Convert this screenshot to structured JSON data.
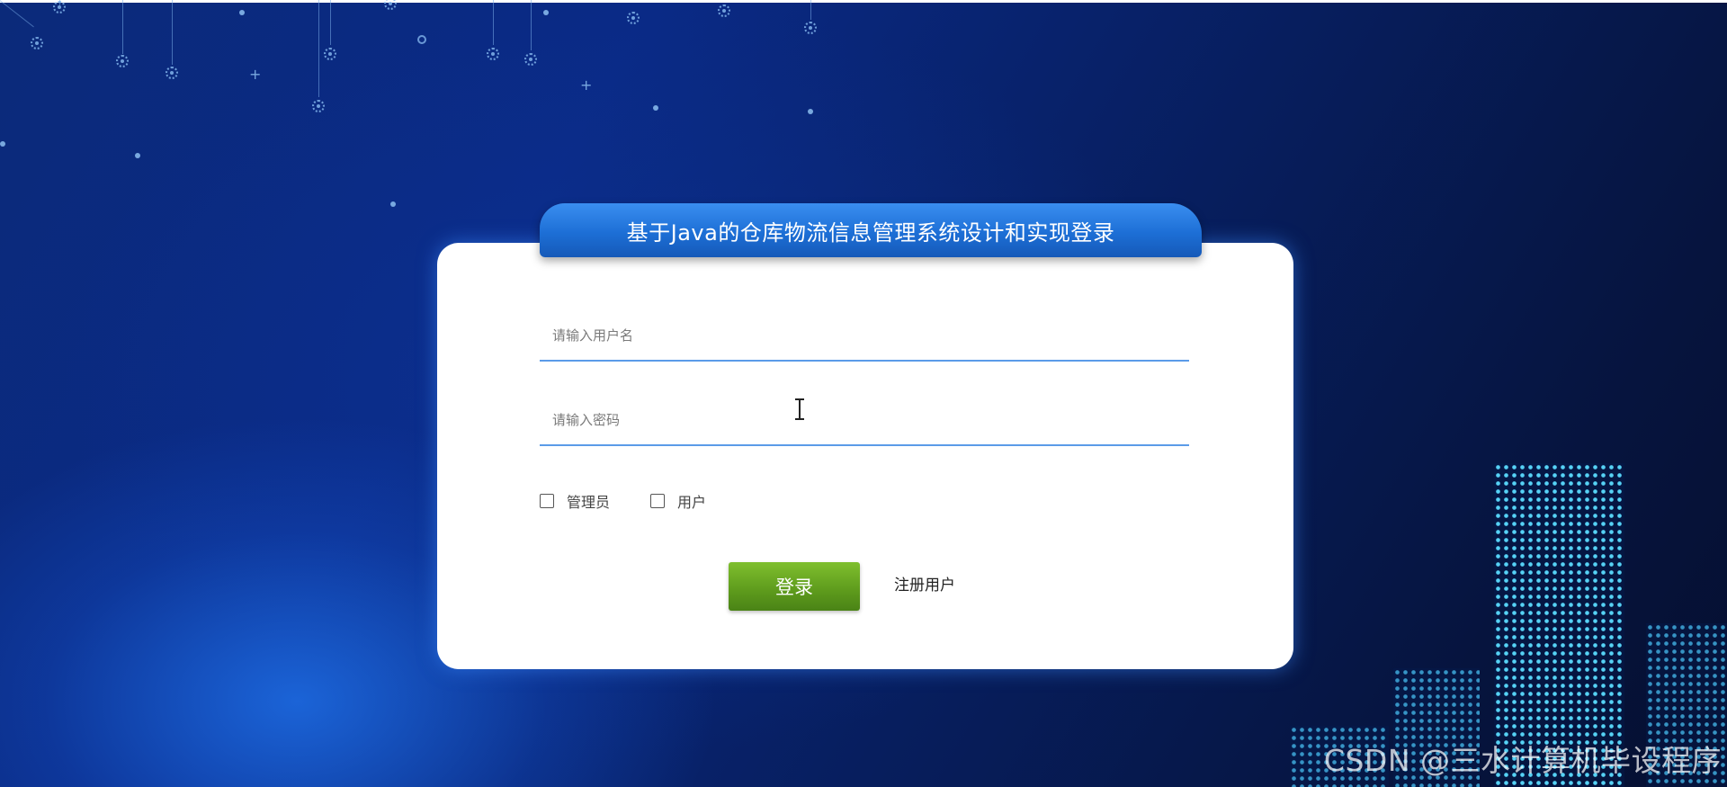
{
  "page": {
    "title": "基于Java的仓库物流信息管理系统设计和实现登录"
  },
  "login_form": {
    "username_placeholder": "请输入用户名",
    "username_value": "",
    "password_placeholder": "请输入密码",
    "password_value": "",
    "roles": [
      {
        "label": "管理员",
        "checked": false
      },
      {
        "label": "用户",
        "checked": false
      }
    ],
    "login_label": "登录",
    "register_label": "注册用户"
  },
  "watermark": {
    "text": "CSDN @三水计算机毕设程序"
  },
  "colors": {
    "title_tab": "#1d6fd6",
    "field_underline": "#5b9be8",
    "login_button": "#5d9a1c",
    "background": "#0a2a86",
    "city_lights": "#5adcff"
  },
  "icons": {
    "decoration": "gear-icon",
    "cursor": "text-cursor-icon"
  }
}
